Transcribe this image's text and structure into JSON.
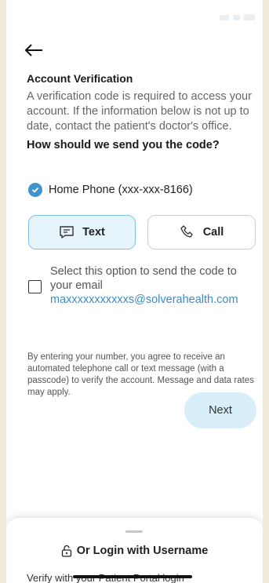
{
  "header": {
    "back_icon": "arrow-left-icon"
  },
  "verification": {
    "title": "Account Verification",
    "description": "A verification code is required to access your account. If the information below is not up to date, contact the patient's doctor's office.",
    "question": "How should we send you the code?"
  },
  "phone_option": {
    "label": "Home Phone (xxx-xxx-8166)",
    "selected": true
  },
  "methods": {
    "text_label": "Text",
    "call_label": "Call",
    "selected": "Text"
  },
  "email_option": {
    "label": "Select this option to send the code to your email",
    "email": "maxxxxxxxxxxxs@solverahealth.com",
    "checked": false
  },
  "disclaimer": "By entering your number, you agree to receive an automated telephone call or text message (with a passcode) to verify the account. Message and data rates may apply.",
  "next_label": "Next",
  "bottom_sheet": {
    "alt_login_label": "Or Login with Username",
    "alt_login_sub": "Verify with your Patient Portal login"
  },
  "colors": {
    "accent": "#3f93d0",
    "selected_bg": "#e6f4fb",
    "next_bg": "#d8eef9",
    "link": "#3a8cc8"
  }
}
